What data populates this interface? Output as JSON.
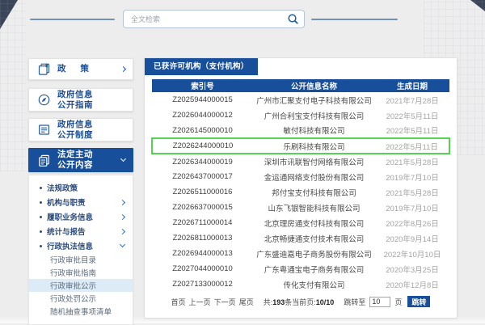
{
  "colors": {
    "primary_blue": "#174f9b",
    "highlight_green": "#52d452",
    "submenu_active_bg": "#dcebf5",
    "page_bg": "#ededed"
  },
  "search": {
    "placeholder": "全文检索"
  },
  "sidebar": {
    "menu": [
      {
        "label": "政 策"
      },
      {
        "line1": "政府信息",
        "line2": "公开指南"
      },
      {
        "line1": "政府信息",
        "line2": "公开制度"
      },
      {
        "line1": "法定主动",
        "line2": "公开内容"
      }
    ],
    "submenu": [
      {
        "label": "法规政策"
      },
      {
        "label": "机构与职责"
      },
      {
        "label": "履职业务信息"
      },
      {
        "label": "统计与报告"
      },
      {
        "label": "行政执法信息"
      }
    ],
    "subsubmenu": [
      {
        "label": "行政审批目录"
      },
      {
        "label": "行政审批指南"
      },
      {
        "label": "行政审批公示",
        "active": true
      },
      {
        "label": "行政处罚公示"
      },
      {
        "label": "随机抽查事项清单"
      }
    ]
  },
  "main": {
    "tab_title": "已获许可机构（支付机构）",
    "table": {
      "headers": [
        "索引号",
        "公开信息名称",
        "生成日期"
      ],
      "highlighted_row": 3,
      "rows": [
        [
          "Z2025944000015",
          "广州市汇聚支付电子科技有限公司",
          "2021年7月28日"
        ],
        [
          "Z2026044000012",
          "广州合利宝支付科技有限公司",
          "2022年5月11日"
        ],
        [
          "Z2026145000010",
          "敏付科技有限公司",
          "2022年5月11日"
        ],
        [
          "Z2026244000010",
          "乐刷科技有限公司",
          "2022年5月11日"
        ],
        [
          "Z2026344000019",
          "深圳市讯联智付网络有限公司",
          "2021年5月28日"
        ],
        [
          "Z2026437000017",
          "金运通网络支付股份有限公司",
          "2019年7月10日"
        ],
        [
          "Z2026511000016",
          "邦付宝支付科技有限公司",
          "2021年5月28日"
        ],
        [
          "Z2026637000015",
          "山东飞银智能科技有限公司",
          "2019年7月10日"
        ],
        [
          "Z2026711000014",
          "北京理房通支付科技有限公司",
          "2022年8月26日"
        ],
        [
          "Z2026811000013",
          "北京畅捷通支付技术有限公司",
          "2020年9月14日"
        ],
        [
          "Z2026944000013",
          "广东盛迪嘉电子商务股份有限公司",
          "2022年10月10日"
        ],
        [
          "Z2027044000010",
          "广东粤通宝电子商务有限公司",
          "2020年3月25日"
        ],
        [
          "Z2027133000012",
          "传化支付有限公司",
          "2020年12月8日"
        ]
      ]
    },
    "pagination": {
      "first": "首页",
      "prev": "上一页",
      "next": "下一页",
      "last": "尾页",
      "total_prefix": "共:",
      "total": "193",
      "total_suffix": "条",
      "current_prefix": "当前页:",
      "current": "10/10",
      "jump_prefix": "跳转至",
      "jump_value": "10",
      "jump_suffix": "页",
      "jump_button": "跳转"
    }
  }
}
